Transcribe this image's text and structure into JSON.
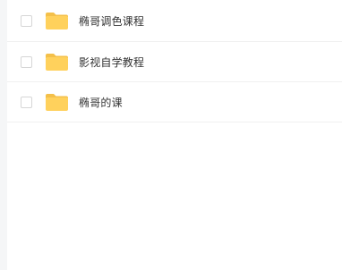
{
  "file_list": {
    "items": [
      {
        "name": "椭哥调色课程",
        "type": "folder"
      },
      {
        "name": "影视自学教程",
        "type": "folder"
      },
      {
        "name": "椭哥的课",
        "type": "folder"
      }
    ]
  },
  "colors": {
    "folder_body": "#FFD15C",
    "folder_tab": "#F4C04A",
    "text": "#333333",
    "checkbox_border": "#D6D6D6",
    "divider": "#F0F0F0",
    "gutter": "#F5F6F7"
  }
}
